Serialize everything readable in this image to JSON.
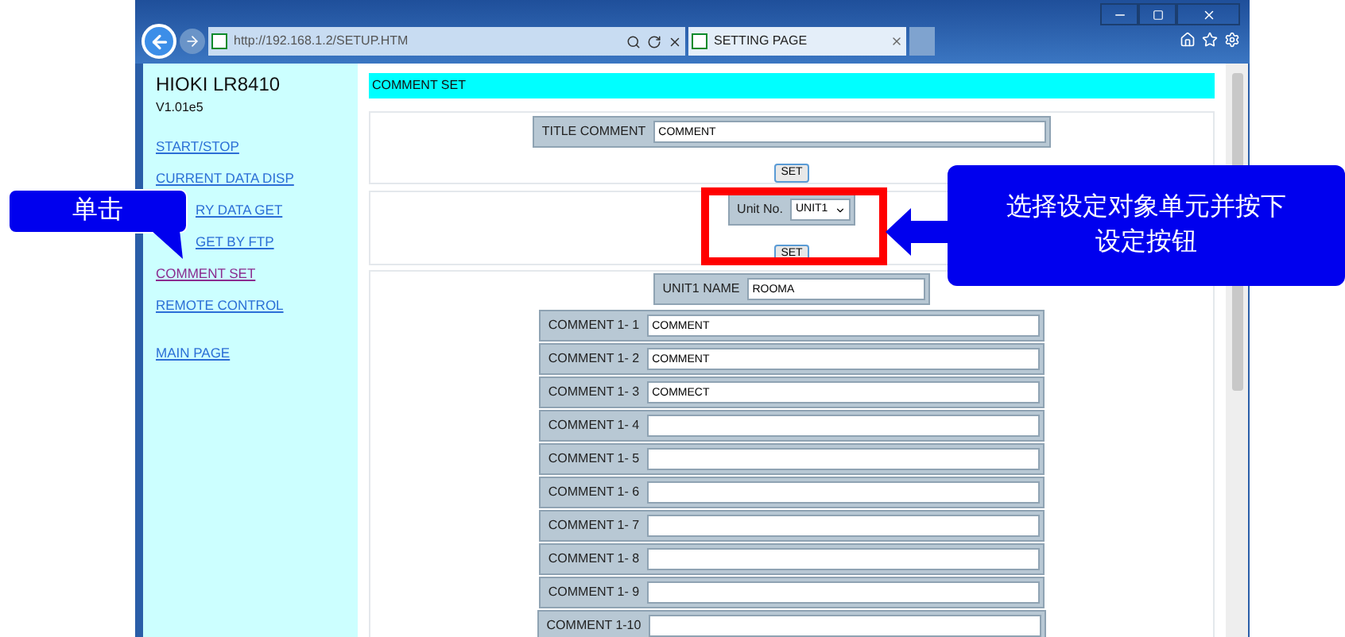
{
  "browser": {
    "address": "http://192.168.1.2/SETUP.HTM",
    "tab": "SETTING PAGE"
  },
  "sidebar": {
    "title": "HIOKI LR8410",
    "version": "V1.01e5",
    "links": [
      {
        "label": "START/STOP",
        "visited": false
      },
      {
        "label": "CURRENT DATA DISP",
        "visited": false
      },
      {
        "label": "RY DATA GET",
        "visited": false
      },
      {
        "label": "GET BY FTP",
        "visited": false
      },
      {
        "label": "COMMENT SET",
        "visited": true
      },
      {
        "label": "REMOTE CONTROL",
        "visited": false
      },
      {
        "label": "MAIN PAGE",
        "visited": false
      }
    ]
  },
  "main": {
    "heading": "COMMENT SET",
    "title_comment": {
      "label": "TITLE COMMENT",
      "value": "COMMENT",
      "button": "SET"
    },
    "unit": {
      "label": "Unit No.",
      "value": "UNIT1",
      "button": "SET"
    },
    "unit_name": {
      "label": "UNIT1 NAME",
      "value": "ROOMA"
    },
    "comments": [
      {
        "label": "COMMENT 1- 1",
        "value": "COMMENT"
      },
      {
        "label": "COMMENT 1- 2",
        "value": "COMMENT"
      },
      {
        "label": "COMMENT 1- 3",
        "value": "COMMECT"
      },
      {
        "label": "COMMENT 1- 4"
      },
      {
        "label": "COMMENT 1- 5"
      },
      {
        "label": "COMMENT 1- 6"
      },
      {
        "label": "COMMENT 1- 7"
      },
      {
        "label": "COMMENT 1- 8"
      },
      {
        "label": "COMMENT 1- 9"
      },
      {
        "label": "COMMENT 1-10"
      }
    ]
  },
  "callouts": [
    {
      "text": "单击"
    },
    {
      "text": "选择设定对象单元并按下设定按钮"
    }
  ]
}
